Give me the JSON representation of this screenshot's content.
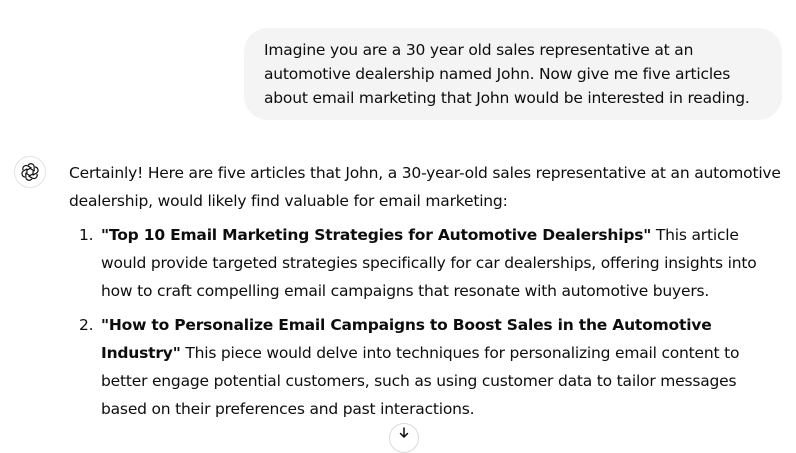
{
  "user_message": {
    "text": "Imagine you are a 30 year old sales representative at an automotive dealership named John. Now give me five articles about email marketing that John would be interested in reading."
  },
  "assistant_message": {
    "intro": "Certainly! Here are five articles that John, a 30-year-old sales representative at an automotive dealership, would likely find valuable for email marketing:",
    "items": [
      {
        "number": "1.",
        "title": "\"Top 10 Email Marketing Strategies for Automotive Dealerships\"",
        "body": " This article would provide targeted strategies specifically for car dealerships, offering insights into how to craft compelling email campaigns that resonate with automotive buyers."
      },
      {
        "number": "2.",
        "title": "\"How to Personalize Email Campaigns to Boost Sales in the Automotive Industry\"",
        "body": " This piece would delve into techniques for personalizing email content to better engage potential customers, such as using customer data to tailor messages based on their preferences and past interactions."
      }
    ]
  },
  "icons": {
    "assistant_avatar": "openai-logo-icon",
    "scroll_down": "arrow-down-icon"
  }
}
